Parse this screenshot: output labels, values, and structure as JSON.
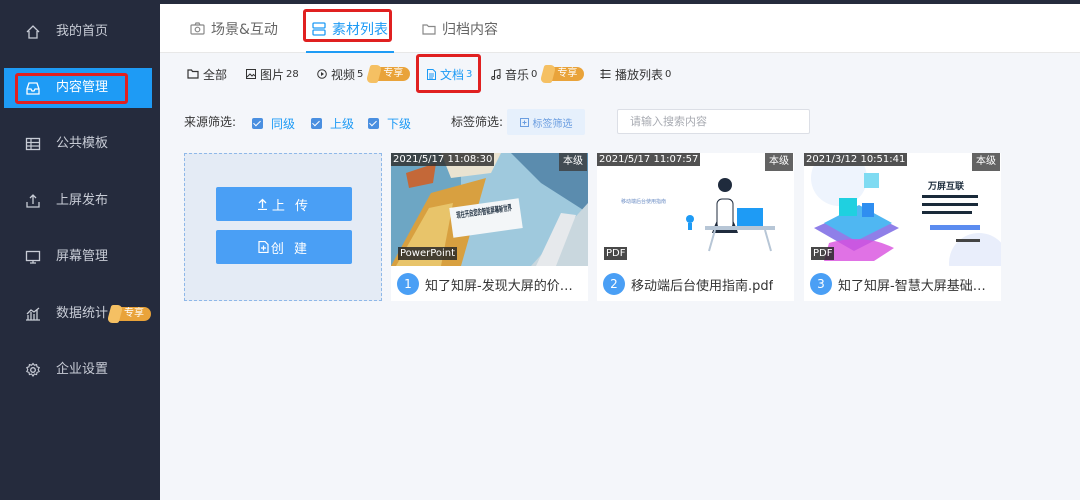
{
  "sidebar": {
    "items": [
      {
        "label": "我的首页",
        "icon": "home-icon"
      },
      {
        "label": "内容管理",
        "icon": "inbox-icon",
        "active": true
      },
      {
        "label": "公共模板",
        "icon": "table-icon"
      },
      {
        "label": "上屏发布",
        "icon": "upload-icon"
      },
      {
        "label": "屏幕管理",
        "icon": "monitor-icon"
      },
      {
        "label": "数据统计",
        "icon": "bar-chart-icon",
        "badge": "专享"
      },
      {
        "label": "企业设置",
        "icon": "gear-icon"
      }
    ]
  },
  "main_tabs": [
    {
      "label": "场景&互动",
      "icon": "camera-icon"
    },
    {
      "label": "素材列表",
      "icon": "list-icon",
      "active": true
    },
    {
      "label": "归档内容",
      "icon": "folder-icon"
    }
  ],
  "filter_tabs": [
    {
      "label": "全部",
      "count": "",
      "icon": "folder-icon"
    },
    {
      "label": "图片",
      "count": "28",
      "icon": "image-icon"
    },
    {
      "label": "视频",
      "count": "5",
      "icon": "play-icon",
      "badge": "专享"
    },
    {
      "label": "文档",
      "count": "3",
      "icon": "document-icon",
      "active": true
    },
    {
      "label": "音乐",
      "count": "0",
      "icon": "music-icon",
      "badge": "专享"
    },
    {
      "label": "播放列表",
      "count": "0",
      "icon": "playlist-icon"
    }
  ],
  "filters": {
    "source_label": "来源筛选:",
    "options": [
      "同级",
      "上级",
      "下级"
    ],
    "tag_label": "标签筛选:",
    "tag_button": "标签筛选",
    "search_placeholder": "请输入搜索内容"
  },
  "upload": {
    "upload_label": "上 传",
    "create_label": "创 建"
  },
  "cards": [
    {
      "timestamp": "2021/5/17 11:08:30",
      "level": "本级",
      "type": "PowerPoint",
      "index": "1",
      "title": "知了知屏-发现大屏的价值.pptx",
      "thumb_text": "现在开启您的智能屏幕新世界"
    },
    {
      "timestamp": "2021/5/17 11:07:57",
      "level": "本级",
      "type": "PDF",
      "index": "2",
      "title": "移动端后台使用指南.pdf",
      "thumb_text": "移动端后台使用指南"
    },
    {
      "timestamp": "2021/3/12 10:51:41",
      "level": "本级",
      "type": "PDF",
      "index": "3",
      "title": "知了知屏-智慧大屏基础介绍.pdf",
      "thumb_text": "万屏互联"
    }
  ],
  "colors": {
    "accent": "#1e9bf5",
    "sidebar_bg": "#252b3d",
    "badge": "#e9a33a",
    "highlight": "#e02020"
  }
}
